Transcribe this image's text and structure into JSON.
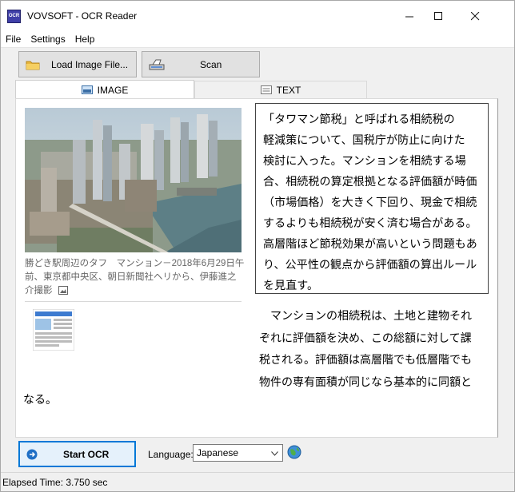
{
  "window": {
    "title": "VOVSOFT - OCR Reader",
    "icon_text": "OCR"
  },
  "menu": [
    "File",
    "Settings",
    "Help"
  ],
  "toolbar": {
    "load_label": "Load Image File...",
    "scan_label": "Scan"
  },
  "tabs": {
    "image_label": "IMAGE",
    "text_label": "TEXT"
  },
  "image": {
    "caption": "勝どき駅周辺のタフ　マンション－2018年6月29日午前、東京都中央区、朝日新聞社ヘリから、伊藤進之介撮影"
  },
  "article": {
    "box_lines": [
      "「タワマン節税」と呼ばれる相続税の",
      "軽減策について、国税庁が防止に向けた",
      "検討に入った。マンションを相続する場",
      "合、相続税の算定根拠となる評価額が時価",
      "（市場価格）を大きく下回り、現金で相続",
      "するよりも相続税が安く済む場合がある。",
      "高層階ほど節税効果が高いという問題もあ",
      "り、公平性の観点から評価額の算出ルール",
      "を見直す。"
    ],
    "body_lines": [
      "　マンションの相続税は、土地と建物それ",
      "ぞれに評価額を決め、この総額に対して課",
      "税される。評価額は高層階でも低層階でも",
      "物件の専有面積が同じなら基本的に同額と"
    ],
    "body_tail": "なる。"
  },
  "bottom": {
    "start_label": "Start OCR",
    "language_label": "Language:",
    "language_value": "Japanese"
  },
  "status": {
    "elapsed": "Elapsed Time: 3.750 sec"
  },
  "colors": {
    "accent": "#0078d7",
    "start_bg": "#e5f1fb",
    "window_bg": "#f0f0f0"
  }
}
